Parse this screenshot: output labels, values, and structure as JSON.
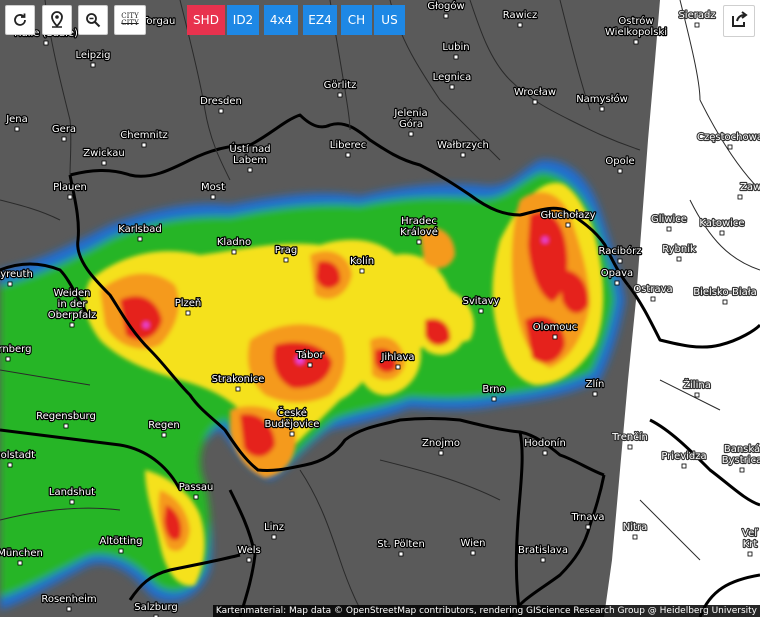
{
  "toolbar": {
    "refresh_icon": "refresh-icon",
    "location_icon": "map-pin-icon",
    "zoom_out_icon": "zoom-out-icon",
    "city_toggle_line1": "CITY",
    "city_toggle_line2": "CITY"
  },
  "modes": [
    {
      "label": "SHD",
      "active": true,
      "color": "#e8324e"
    },
    {
      "label": "ID2",
      "active": false,
      "color": "#1e88e5"
    },
    {
      "label": "4x4",
      "active": false,
      "color": "#1e88e5"
    },
    {
      "label": "EZ4",
      "active": false,
      "color": "#1e88e5"
    },
    {
      "label": "CH",
      "active": false,
      "color": "#1e88e5"
    },
    {
      "label": "US",
      "active": false,
      "color": "#1e88e5"
    }
  ],
  "export_icon": "share-export-icon",
  "attribution": "Kartenmaterial: Map data © OpenStreetMap contributors, rendering GIScience Research Group @ Heidelberg University",
  "colors": {
    "background": "#5a5a5a",
    "no_data": "#ffffff",
    "border": "#000000",
    "road": "#a0a0a0"
  },
  "cities": [
    {
      "name": "Głogów"
    },
    {
      "name": "Rawicz"
    },
    {
      "name": "Ostrów Wielkopolski"
    },
    {
      "name": "Sieradz"
    },
    {
      "name": "Halle (Saale)"
    },
    {
      "name": "Torgau"
    },
    {
      "name": "Leipzig"
    },
    {
      "name": "Lubin"
    },
    {
      "name": "Görlitz"
    },
    {
      "name": "Legnica"
    },
    {
      "name": "Wrocław"
    },
    {
      "name": "Namysłów"
    },
    {
      "name": "Dresden"
    },
    {
      "name": "Jena"
    },
    {
      "name": "Gera"
    },
    {
      "name": "Chemnitz"
    },
    {
      "name": "Jelenia Góra"
    },
    {
      "name": "Częstochowa"
    },
    {
      "name": "Zwickau"
    },
    {
      "name": "Ústí nad Labem"
    },
    {
      "name": "Liberec"
    },
    {
      "name": "Wałbrzych"
    },
    {
      "name": "Opole"
    },
    {
      "name": "Plauen"
    },
    {
      "name": "Most"
    },
    {
      "name": "Zawie"
    },
    {
      "name": "Karlsbad"
    },
    {
      "name": "Kladno"
    },
    {
      "name": "Prag"
    },
    {
      "name": "Hradec Králové"
    },
    {
      "name": "Głuchołazy"
    },
    {
      "name": "Gliwice"
    },
    {
      "name": "Katowice"
    },
    {
      "name": "Kolín"
    },
    {
      "name": "Racibórz"
    },
    {
      "name": "Rybnik"
    },
    {
      "name": "Bayreuth"
    },
    {
      "name": "Opava"
    },
    {
      "name": "Weiden in der Oberpfalz"
    },
    {
      "name": "Plzeň"
    },
    {
      "name": "Svitavy"
    },
    {
      "name": "Ostrava"
    },
    {
      "name": "Bielsko-Biała"
    },
    {
      "name": "Olomouc"
    },
    {
      "name": "Nürnberg"
    },
    {
      "name": "Tábor"
    },
    {
      "name": "Jihlava"
    },
    {
      "name": "Strakonice"
    },
    {
      "name": "Brno"
    },
    {
      "name": "Zlín"
    },
    {
      "name": "Žilina"
    },
    {
      "name": "Regensburg"
    },
    {
      "name": "České Budějovice"
    },
    {
      "name": "Regen"
    },
    {
      "name": "Znojmo"
    },
    {
      "name": "Hodonín"
    },
    {
      "name": "Trenčín"
    },
    {
      "name": "Ingolstadt"
    },
    {
      "name": "Prievidza"
    },
    {
      "name": "Banská Bystrica"
    },
    {
      "name": "Passau"
    },
    {
      "name": "Landshut"
    },
    {
      "name": "Trnava"
    },
    {
      "name": "Linz"
    },
    {
      "name": "Nitra"
    },
    {
      "name": "Altötting"
    },
    {
      "name": "St. Pölten"
    },
    {
      "name": "Wien"
    },
    {
      "name": "Wels"
    },
    {
      "name": "Bratislava"
    },
    {
      "name": "München"
    },
    {
      "name": "Veľký Krtíš"
    },
    {
      "name": "Rosenheim"
    },
    {
      "name": "Salzburg"
    }
  ]
}
